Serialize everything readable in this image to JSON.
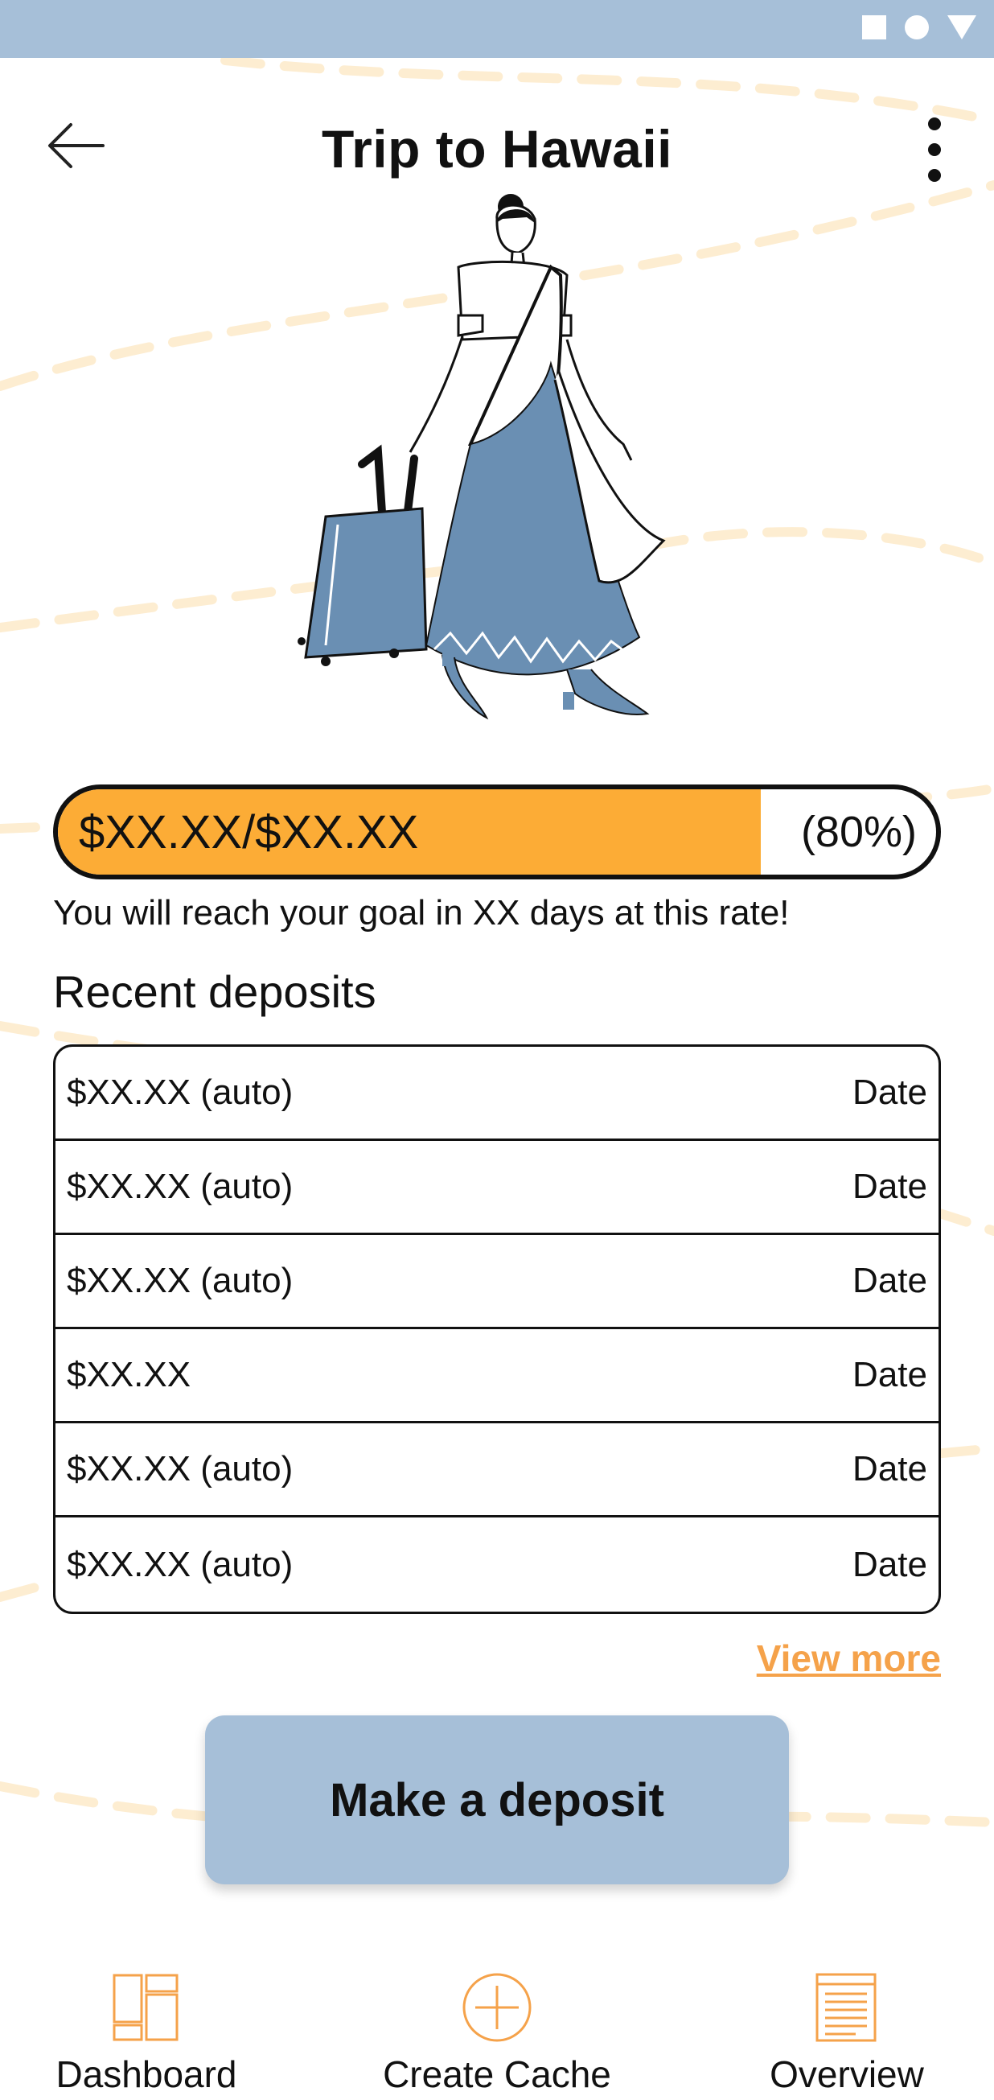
{
  "header": {
    "title": "Trip to Hawaii",
    "back_icon": "arrow-left-icon",
    "menu_icon": "more-vertical-icon"
  },
  "status_bar": {
    "icons": [
      "square-icon",
      "circle-icon",
      "triangle-icon"
    ]
  },
  "progress": {
    "amount_text": "$XX.XX/$XX.XX",
    "percent_text": "(80%)",
    "fraction": 0.8
  },
  "goal_message": "You will reach your goal in XX days at this rate!",
  "recent_deposits": {
    "title": "Recent deposits",
    "rows": [
      {
        "amount": "$XX.XX (auto)",
        "date": "Date"
      },
      {
        "amount": "$XX.XX (auto)",
        "date": "Date"
      },
      {
        "amount": "$XX.XX (auto)",
        "date": "Date"
      },
      {
        "amount": "$XX.XX",
        "date": "Date"
      },
      {
        "amount": "$XX.XX (auto)",
        "date": "Date"
      },
      {
        "amount": "$XX.XX (auto)",
        "date": "Date"
      }
    ],
    "view_more": "View more"
  },
  "actions": {
    "deposit_label": "Make a deposit"
  },
  "bottom_nav": {
    "items": [
      {
        "label": "Dashboard",
        "icon": "dashboard-icon"
      },
      {
        "label": "Create Cache",
        "icon": "plus-circle-icon"
      },
      {
        "label": "Overview",
        "icon": "document-icon"
      }
    ]
  },
  "colors": {
    "accent": "#fcac36",
    "primary": "#a6bfd8",
    "illustration_blue": "#6a8fb3",
    "link": "#f5a24a"
  }
}
